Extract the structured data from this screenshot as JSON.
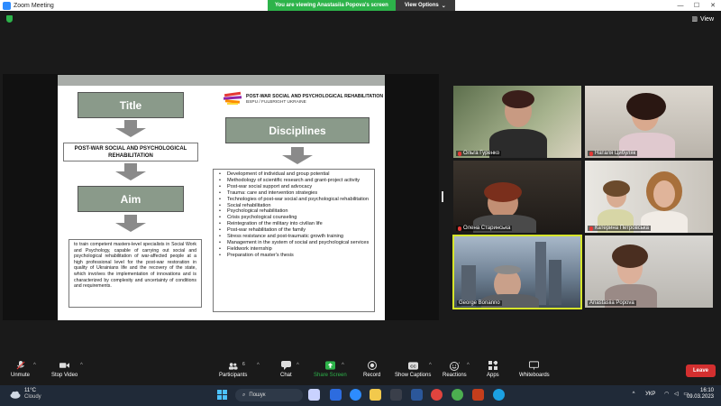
{
  "window": {
    "title": "Zoom Meeting"
  },
  "share_banner": {
    "message": "You are viewing Anastasiia Popova's screen",
    "options_label": "View Options"
  },
  "view_button": {
    "label": "View"
  },
  "slide": {
    "title_box": "Title",
    "post_war_title": "POST-WAR SOCIAL AND PSYCHOLOGICAL REHABILITATION",
    "aim_box": "Aim",
    "aim_text": "to train competent masters-level specialists in Social Work and Psychology, capable of carrying out social and psychological rehabilitation of war-affected people at a high professional level for the post-war restoration in quality of Ukrainians life and the recovery of the state, which involves the implementation of innovations and is characterized by complexity and uncertainty of conditions and requirements.",
    "logo_line1": "POST-WAR SOCIAL AND PSYCHOLOGICAL REHABILITATION",
    "logo_line2": "BSPU / FULBRIGHT UKRAINE",
    "disciplines_box": "Disciplines",
    "disciplines": [
      "Development of individual and group potential",
      "Methodology of scientific research and grant-project activity",
      "Post-war social support and advocacy",
      "Trauma: care and intervention strategies",
      "Technologies of post-war social and psychological rehabilitation",
      "Social rehabilitation",
      "Psychological rehabilitation",
      "Crisis psychological counseling",
      "Reintegration of the military into civilian life",
      "Post-war rehabilitation of the family",
      "Stress resistance and post-traumatic growth training",
      "Management in the system of social and psychological services",
      "Fieldwork internship",
      "Preparation of master's thesis"
    ]
  },
  "participants": [
    {
      "name": "Ольга Гуренко"
    },
    {
      "name": "Наталя Цибуляк"
    },
    {
      "name": "Олена Старинська"
    },
    {
      "name": "Катерина Петровська"
    },
    {
      "name": "George Bonanno"
    },
    {
      "name": "Anastasiia Popova"
    }
  ],
  "toolbar": {
    "unmute": "Unmute",
    "stop_video": "Stop Video",
    "participants": "Participants",
    "participants_count": "6",
    "chat": "Chat",
    "share_screen": "Share Screen",
    "record": "Record",
    "show_captions": "Show Captions",
    "reactions": "Reactions",
    "apps": "Apps",
    "whiteboards": "Whiteboards",
    "leave": "Leave"
  },
  "taskbar": {
    "weather_temp": "11°C",
    "weather_desc": "Cloudy",
    "search_placeholder": "Пошук",
    "language": "УКР",
    "time": "16:10",
    "date": "09.03.2023"
  },
  "colors": {
    "share_green": "#2db34a",
    "leave_red": "#d32f2f",
    "active_speaker": "#d6e52a",
    "slide_box": "#8a9a8a"
  }
}
